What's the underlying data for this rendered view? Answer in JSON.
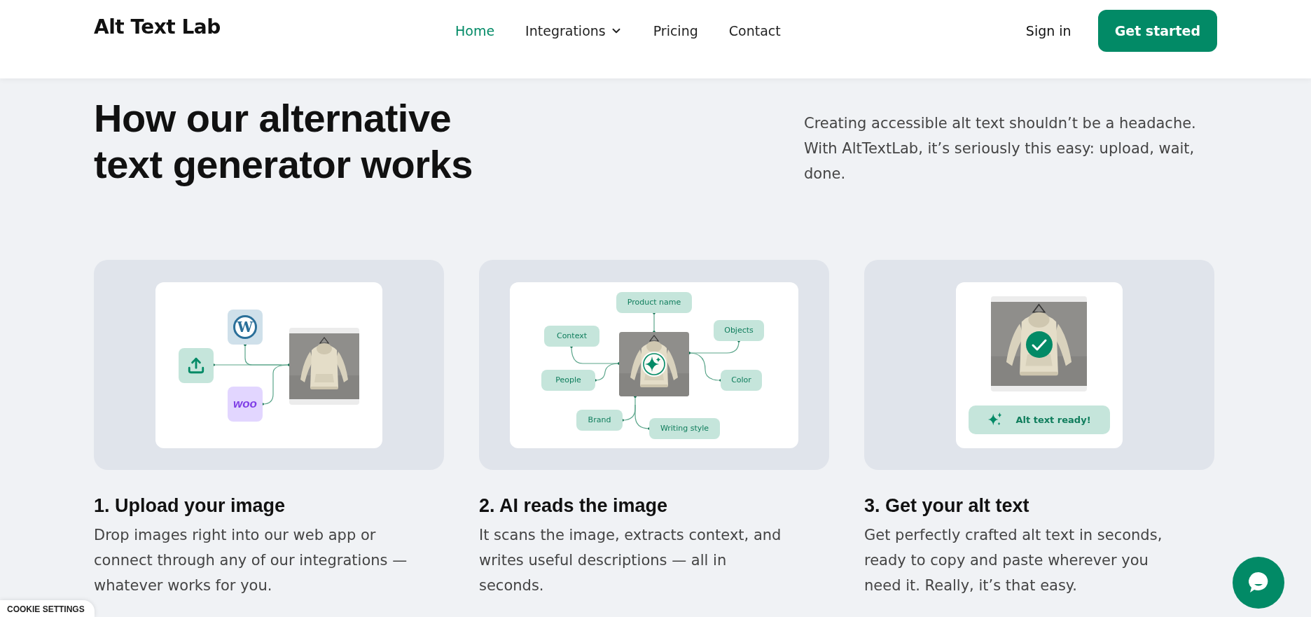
{
  "header": {
    "logo": "Alt Text Lab",
    "nav": [
      {
        "label": "Home",
        "selected": true,
        "dropdown": false
      },
      {
        "label": "Integrations",
        "selected": false,
        "dropdown": true
      },
      {
        "label": "Pricing",
        "selected": false,
        "dropdown": false
      },
      {
        "label": "Contact",
        "selected": false,
        "dropdown": false
      }
    ],
    "sign_in": "Sign in",
    "cta": "Get started"
  },
  "intro": {
    "heading": "How our alternative text generator works",
    "description": "Creating accessible alt text shouldn’t be a headache. With AltTextLab, it’s seriously this easy: upload, wait, done."
  },
  "steps": [
    {
      "kind": "upload",
      "title": "1. Upload your image",
      "description": "Drop images right into our web app or connect through any of our integrations — whatever works for you.",
      "wordpress_mark": "W",
      "woo_logo": "woo"
    },
    {
      "kind": "analyze",
      "title": "2. AI reads the image",
      "description": "It scans the image, extracts context, and writes useful descriptions — all in seconds.",
      "chips": [
        "Product name",
        "Context",
        "Objects",
        "People",
        "Color",
        "Brand",
        "Writing style"
      ]
    },
    {
      "kind": "result",
      "title": "3. Get your alt text",
      "description": "Get perfectly crafted alt text in seconds, ready to copy and paste wherever you need it. Really, it’s that easy.",
      "status": "Alt text ready!"
    }
  ],
  "cookie_settings": "COOKIE SETTINGS"
}
